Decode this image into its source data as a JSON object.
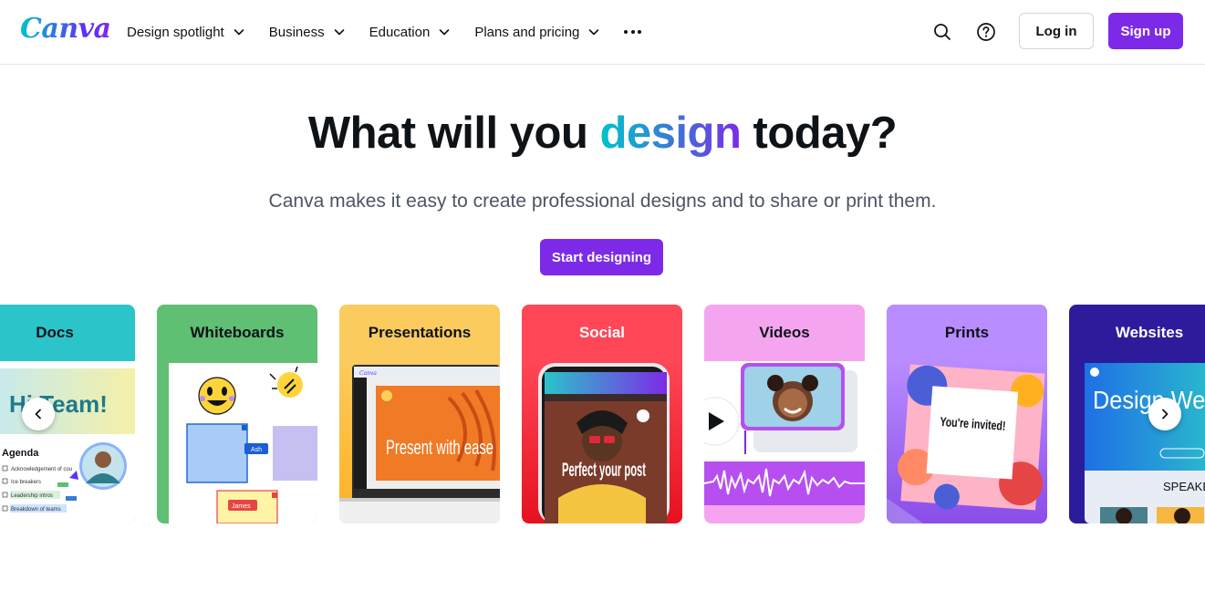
{
  "header": {
    "logo_text": "Canva",
    "nav": [
      {
        "label": "Design spotlight"
      },
      {
        "label": "Business"
      },
      {
        "label": "Education"
      },
      {
        "label": "Plans and pricing"
      }
    ],
    "more_icon": "more-horizontal-icon",
    "search_icon": "search-icon",
    "help_icon": "help-circle-icon",
    "login_label": "Log in",
    "signup_label": "Sign up"
  },
  "hero": {
    "title_before": "What will you ",
    "title_accent": "design",
    "title_after": " today?",
    "subtitle": "Canva makes it easy to create professional designs and to share or print them.",
    "cta_label": "Start designing"
  },
  "categories": [
    {
      "label": "Docs",
      "color": "#2bc4c9"
    },
    {
      "label": "Whiteboards",
      "color": "#5fbf73"
    },
    {
      "label": "Presentations",
      "color": "#fbcb5e"
    },
    {
      "label": "Social",
      "color": "#ff4757"
    },
    {
      "label": "Videos",
      "color": "#f5a5f0"
    },
    {
      "label": "Prints",
      "color": "#b98cff"
    },
    {
      "label": "Websites",
      "color": "#2c1c9c"
    }
  ],
  "card_art_text": {
    "docs_headline": "Hi Team!",
    "docs_agenda": "Agenda",
    "docs_items": [
      "Acknowledgement of cou",
      "Ice breakers",
      "Leadership intros",
      "Breakdown of teams"
    ],
    "wb_name_1": "Ash",
    "wb_name_2": "James",
    "pres_app": "Canva",
    "pres_text": "Present with ease",
    "social_text": "Perfect your post",
    "prints_text": "You're invited!",
    "web_headline": "Design Webs",
    "web_speaker": "SPEAKER"
  },
  "carousel": {
    "prev_icon": "chevron-left-icon",
    "next_icon": "chevron-right-icon"
  },
  "colors": {
    "brand_purple": "#7d2ae8",
    "text_dark": "#0e1318",
    "text_muted": "#4b5563"
  }
}
